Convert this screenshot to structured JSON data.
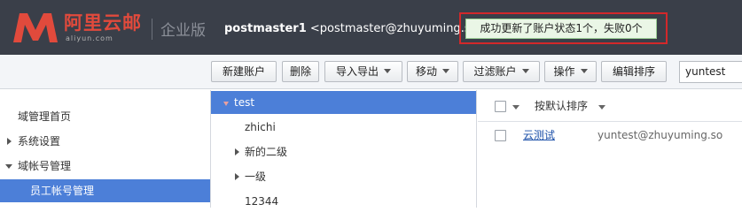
{
  "header": {
    "logo_text": "阿里云邮",
    "logo_domain": "aliyun.com",
    "edition": "企业版",
    "username": "postmaster1",
    "email": "<postmaster@zhuyuming.so>",
    "notice": "成功更新了账户状态1个，失败0个"
  },
  "toolbar": {
    "new_account": "新建账户",
    "delete": "删除",
    "import_export": "导入导出",
    "move": "移动",
    "filter": "过滤账户",
    "operate": "操作",
    "edit_sort": "编辑排序",
    "search_value": "yuntest"
  },
  "sidebar": {
    "items": [
      {
        "label": "域管理首页"
      },
      {
        "label": "系统设置"
      },
      {
        "label": "域帐号管理"
      },
      {
        "label": "员工帐号管理"
      }
    ]
  },
  "tree": {
    "items": [
      {
        "label": "test"
      },
      {
        "label": "zhichi"
      },
      {
        "label": "新的二级"
      },
      {
        "label": "一级"
      },
      {
        "label": "12344"
      }
    ]
  },
  "list": {
    "sort_label": "按默认排序",
    "rows": [
      {
        "name": "云测试",
        "email": "yuntest@zhuyuming.so"
      }
    ]
  },
  "colors": {
    "header_bg": "#3a3f49",
    "brand_red": "#e14a3c",
    "selection_blue": "#4c7fd8",
    "notice_border": "#d3282a",
    "notice_bg": "#eaf6e6"
  }
}
